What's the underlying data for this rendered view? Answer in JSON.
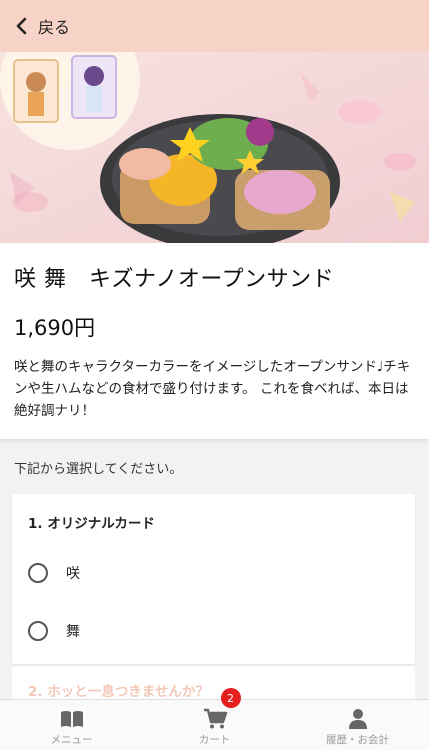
{
  "header": {
    "back_label": "戻る"
  },
  "product": {
    "title": "咲 舞　キズナノオープンサンド",
    "price": "1,690円",
    "description": "咲と舞のキャラクターカラーをイメージしたオープンサンド♩チキンや生ハムなどの食材で盛り付けます。 これを食べれば、本日は絶好調ナリ！"
  },
  "instruction": "下記から選択してください。",
  "options": [
    {
      "title": "1. オリジナルカード",
      "choices": [
        {
          "label": "咲",
          "selected": false
        },
        {
          "label": "舞",
          "selected": false
        }
      ]
    },
    {
      "title": "2. ホッと一息つきませんか？"
    }
  ],
  "tabbar": {
    "items": [
      {
        "label": "メニュー",
        "icon": "book-icon"
      },
      {
        "label": "カート",
        "icon": "cart-icon",
        "badge": "2"
      },
      {
        "label": "履歴・お会計",
        "icon": "person-icon"
      }
    ]
  },
  "colors": {
    "header_bg": "#f6d3c6",
    "badge": "#e51f1f",
    "muted_title": "#f3c8b7"
  }
}
